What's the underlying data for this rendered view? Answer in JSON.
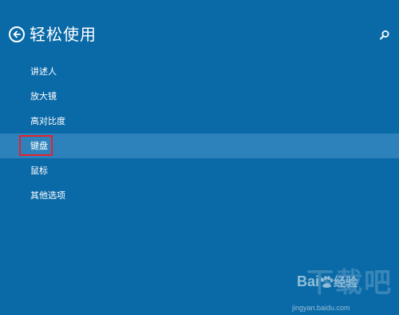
{
  "header": {
    "title": "轻松使用"
  },
  "menu": {
    "items": [
      {
        "label": "讲述人"
      },
      {
        "label": "放大镜"
      },
      {
        "label": "高对比度"
      },
      {
        "label": "键盘"
      },
      {
        "label": "鼠标"
      },
      {
        "label": "其他选项"
      }
    ],
    "selected_index": 3
  },
  "watermark": {
    "big_text": "下载吧",
    "brand": "Bai",
    "brand_suffix": "经验",
    "url": "jingyan.baidu.com"
  },
  "colors": {
    "background": "#0a6aa8",
    "selected_row": "#2e82bb",
    "highlight_border": "#e8202a",
    "text": "#ffffff"
  },
  "icons": {
    "back": "back-arrow-circle-icon",
    "search": "search-icon"
  }
}
